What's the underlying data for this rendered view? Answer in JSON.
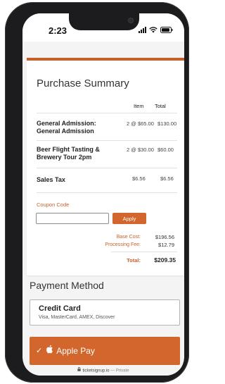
{
  "status_bar": {
    "time": "2:23"
  },
  "summary": {
    "title": "Purchase Summary",
    "col_item": "Item",
    "col_total": "Total",
    "rows": [
      {
        "name_line1": "General Admission:",
        "name_line2": "General Admission",
        "qty": "2 @ $65.00",
        "total": "$130.00"
      },
      {
        "name_line1": "Beer Flight Tasting &",
        "name_line2": "Brewery Tour 2pm",
        "qty": "2 @ $30.00",
        "total": "$60.00"
      },
      {
        "name_line1": "Sales Tax",
        "name_line2": "",
        "qty": "$6.56",
        "total": "$6.56"
      }
    ],
    "coupon_label": "Coupon Code",
    "coupon_value": "",
    "apply_label": "Apply",
    "base_cost_label": "Base Cost:",
    "base_cost_value": "$196.56",
    "processing_fee_label": "Processing Fee:",
    "processing_fee_value": "$12.79",
    "total_label": "Total:",
    "total_value": "$209.35"
  },
  "payment": {
    "title": "Payment Method",
    "credit_card_title": "Credit Card",
    "credit_card_sub": "Visa, MasterCard, AMEX, Discover",
    "apple_pay_check": "✓",
    "apple_pay_label": "Apple Pay"
  },
  "browser": {
    "url": "ticketsignup.io",
    "separator": " — ",
    "privacy": "Private"
  },
  "colors": {
    "accent": "#d2662c",
    "accent_text": "#c8602a",
    "background": "#f4f4f4"
  },
  "icons": [
    "signal-icon",
    "wifi-icon",
    "battery-icon",
    "check-icon",
    "apple-icon",
    "lock-icon"
  ]
}
